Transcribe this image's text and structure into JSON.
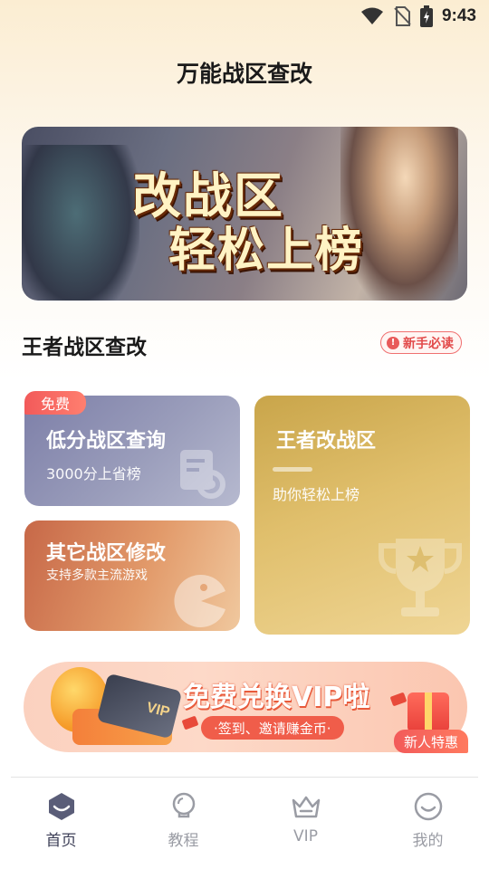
{
  "status_bar": {
    "time": "9:43",
    "icons": [
      "wifi-icon",
      "no-sim-icon",
      "battery-charging-icon"
    ]
  },
  "header": {
    "title": "万能战区查改"
  },
  "banner": {
    "line1": "改战区",
    "line2": "轻松上榜"
  },
  "section": {
    "title": "王者战区查改",
    "guide_label": "新手必读",
    "guide_icon": "info-icon"
  },
  "cards": {
    "query": {
      "tag": "免费",
      "title": "低分战区查询",
      "subtitle": "3000分上省榜",
      "icon": "search-document-icon"
    },
    "other": {
      "title": "其它战区修改",
      "subtitle": "支持多款主流游戏",
      "icon": "game-controller-icon"
    },
    "change": {
      "title": "王者改战区",
      "subtitle": "助你轻松上榜",
      "icon": "trophy-icon"
    }
  },
  "promo": {
    "title": "免费兑换VIP啦",
    "subtitle": "·签到、邀请赚金币·",
    "card_text": "VIP",
    "badge": "新人特惠"
  },
  "bottom_nav": {
    "items": [
      {
        "label": "首页",
        "icon": "home-icon",
        "active": true
      },
      {
        "label": "教程",
        "icon": "lightbulb-icon",
        "active": false
      },
      {
        "label": "VIP",
        "icon": "crown-icon",
        "active": false
      },
      {
        "label": "我的",
        "icon": "smiley-profile-icon",
        "active": false
      }
    ]
  },
  "colors": {
    "accent_red": "#f25a5a",
    "active_nav": "#3d3f57",
    "inactive_nav": "#9a9ca4"
  }
}
